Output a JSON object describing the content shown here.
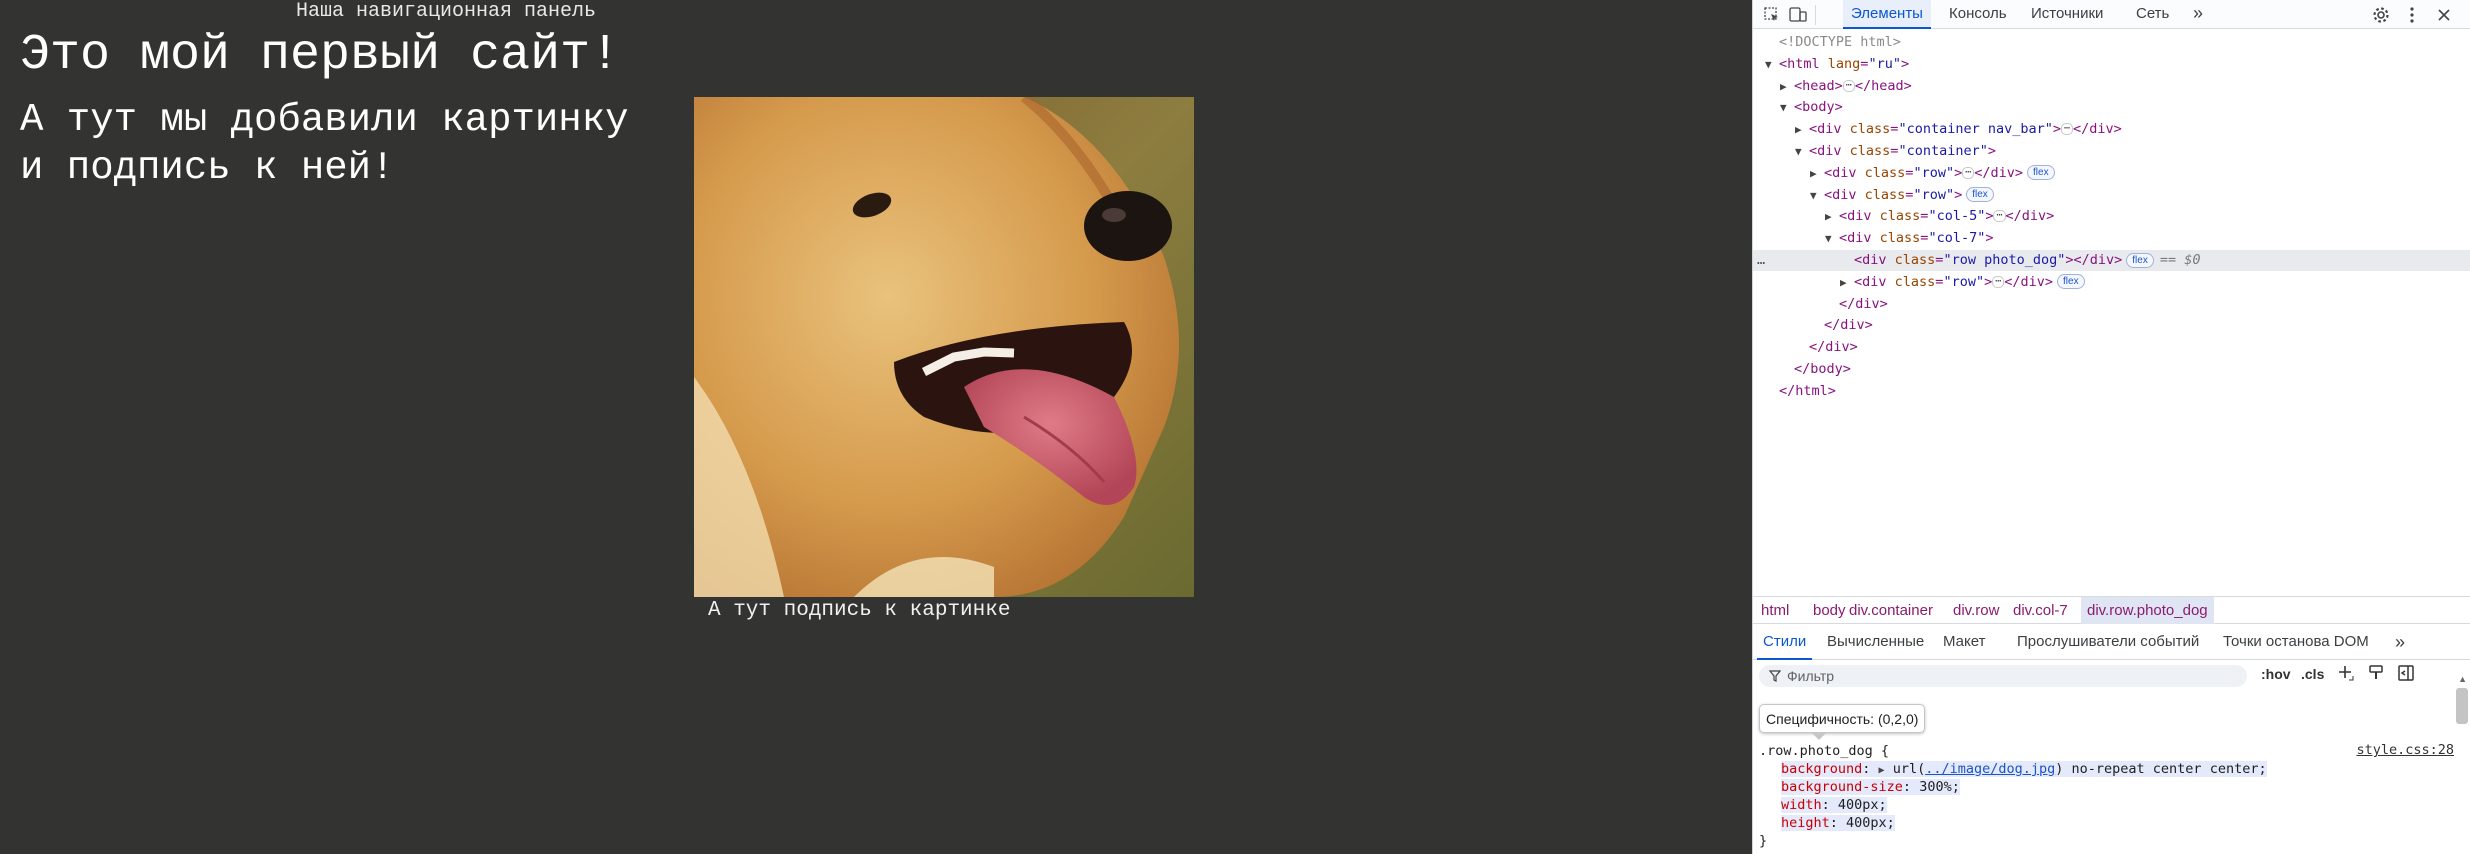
{
  "page": {
    "nav_text": "Наша навигационная панель",
    "heading": "Это мой первый сайт!",
    "sub_line1": "А тут мы добавили картинку",
    "sub_line2": "и подпись к ней!",
    "caption": "А тут подпись к картинке",
    "image_desc": "dog"
  },
  "devtools": {
    "tabs": [
      "Элементы",
      "Консоль",
      "Источники",
      "Сеть"
    ],
    "active_tab": "Элементы",
    "more": "»",
    "dom": [
      {
        "text": "<!DOCTYPE html>",
        "kind": "comment",
        "indent": 0
      },
      {
        "tag": "html",
        "attrs": [
          [
            "lang",
            "ru"
          ]
        ],
        "indent": 0,
        "open": true
      },
      {
        "tag": "head",
        "indent": 1,
        "collapsed": true,
        "close": "head"
      },
      {
        "tag": "body",
        "indent": 1,
        "open": true
      },
      {
        "tag": "div",
        "attrs": [
          [
            "class",
            "container nav_bar"
          ]
        ],
        "indent": 2,
        "collapsed": true,
        "close": "div"
      },
      {
        "tag": "div",
        "attrs": [
          [
            "class",
            "container"
          ]
        ],
        "indent": 2,
        "open": true
      },
      {
        "tag": "div",
        "attrs": [
          [
            "class",
            "row"
          ]
        ],
        "indent": 3,
        "collapsed": true,
        "close": "div",
        "badge": "flex"
      },
      {
        "tag": "div",
        "attrs": [
          [
            "class",
            "row"
          ]
        ],
        "indent": 3,
        "open": true,
        "badge": "flex"
      },
      {
        "tag": "div",
        "attrs": [
          [
            "class",
            "col-5"
          ]
        ],
        "indent": 4,
        "collapsed": true,
        "close": "div"
      },
      {
        "tag": "div",
        "attrs": [
          [
            "class",
            "col-7"
          ]
        ],
        "indent": 4,
        "open": true
      },
      {
        "tag": "div",
        "attrs": [
          [
            "class",
            "row photo_dog"
          ]
        ],
        "indent": 5,
        "empty": true,
        "close": "div",
        "badge": "flex",
        "selected": true,
        "dollar": "== $0"
      },
      {
        "tag": "div",
        "attrs": [
          [
            "class",
            "row"
          ]
        ],
        "indent": 5,
        "collapsed": true,
        "close": "div",
        "badge": "flex"
      },
      {
        "closing": "div",
        "indent": 4
      },
      {
        "closing": "div",
        "indent": 3
      },
      {
        "closing": "div",
        "indent": 2
      },
      {
        "closing": "body",
        "indent": 1
      },
      {
        "closing": "html",
        "indent": 0
      }
    ],
    "breadcrumbs": [
      "html",
      "body",
      "div.container",
      "div.row",
      "div.col-7",
      "div.row.photo_dog"
    ],
    "subtabs": [
      "Стили",
      "Вычисленные",
      "Макет",
      "Прослушиватели событий",
      "Точки останова DOM"
    ],
    "active_subtab": "Стили",
    "filter_placeholder": "Фильтр",
    "hov": ":hov",
    "cls": ".cls",
    "tooltip": "Специфичность: (0,2,0)",
    "rule": {
      "selector": ".row.photo_dog {",
      "source": "style.css:28",
      "bg_prop": "background",
      "bg_url": "../image/dog.jpg",
      "bg_rest": ") no-repeat center center;",
      "bgsize_prop": "background-size",
      "bgsize_val": "300%;",
      "width_prop": "width",
      "width_val": "400px;",
      "height_prop": "height",
      "height_val": "400px;",
      "close": "}"
    }
  }
}
